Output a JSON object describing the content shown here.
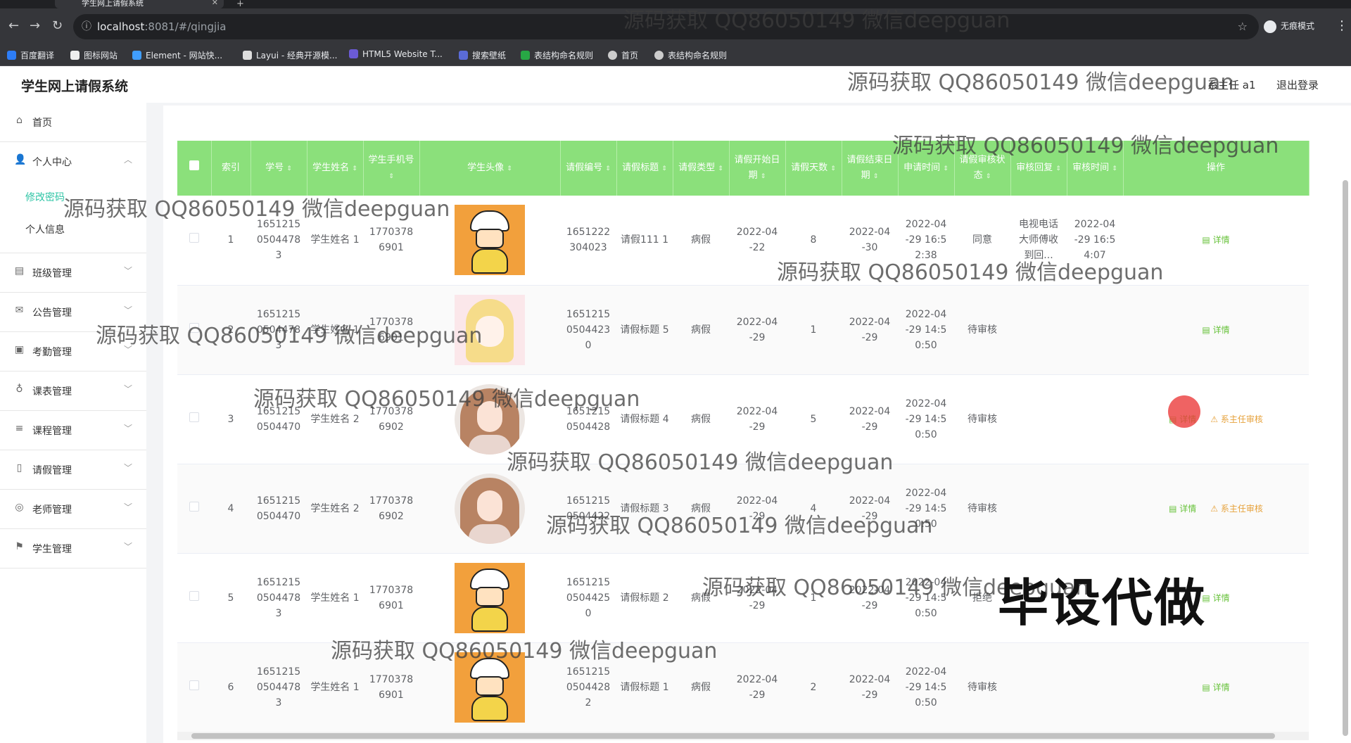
{
  "browser": {
    "tab_title": "学生网上请假系统",
    "url_host": "localhost",
    "url_path": ":8081/#/qingjia",
    "incognito_label": "无痕模式",
    "bookmarks": [
      "百度翻译",
      "图标网站",
      "Element - 网站快...",
      "Layui - 经典开源模...",
      "HTML5 Website T...",
      "搜索壁纸",
      "表结构命名规则",
      "首页",
      "表结构命名规则"
    ]
  },
  "header": {
    "title": "学生网上请假系统",
    "user_role": "系主任 a1",
    "logout": "退出登录"
  },
  "sidebar": {
    "home": "首页",
    "personal_center": "个人中心",
    "change_password": "修改密码",
    "personal_info": "个人信息",
    "items": [
      "班级管理",
      "公告管理",
      "考勤管理",
      "课表管理",
      "课程管理",
      "请假管理",
      "老师管理",
      "学生管理"
    ]
  },
  "table": {
    "headers": [
      "索引",
      "学号",
      "学生姓名",
      "学生手机号",
      "学生头像",
      "请假编号",
      "请假标题",
      "请假类型",
      "请假开始日期",
      "请假天数",
      "请假结束日期",
      "申请时间",
      "请假审核状态",
      "审核回复",
      "审核时间",
      "操作"
    ],
    "detail_label": "详情",
    "review_label": "系主任审核",
    "rows": [
      {
        "index": "1",
        "student_no": "1651215 0504478 3",
        "name": "学生姓名 1",
        "phone": "1770378 6901",
        "avatar": "cartoon",
        "leave_no": "1651222 304023",
        "title": "请假111 1",
        "type": "病假",
        "start": "2022-04 -22",
        "days": "8",
        "end": "2022-04 -30",
        "applied": "2022-04 -29 16:5 2:38",
        "status": "同意",
        "reply": "电视电话 大师傅收 到回...",
        "review_time": "2022-04 -29 16:5 4:07",
        "review_btn": false
      },
      {
        "index": "2",
        "student_no": "1651215 0504478 3",
        "name": "学生姓名 1",
        "phone": "1770378 6901",
        "avatar": "anime",
        "leave_no": "1651215 0504423 0",
        "title": "请假标题 5",
        "type": "病假",
        "start": "2022-04 -29",
        "days": "1",
        "end": "2022-04 -29",
        "applied": "2022-04 -29 14:5 0:50",
        "status": "待审核",
        "reply": "",
        "review_time": "",
        "review_btn": false
      },
      {
        "index": "3",
        "student_no": "1651215 0504470",
        "name": "学生姓名 2",
        "phone": "1770378 6902",
        "avatar": "girl",
        "leave_no": "1651215 0504428",
        "title": "请假标题 4",
        "type": "病假",
        "start": "2022-04 -29",
        "days": "5",
        "end": "2022-04 -29",
        "applied": "2022-04 -29 14:5 0:50",
        "status": "待审核",
        "reply": "",
        "review_time": "",
        "review_btn": true
      },
      {
        "index": "4",
        "student_no": "1651215 0504470",
        "name": "学生姓名 2",
        "phone": "1770378 6902",
        "avatar": "girl",
        "leave_no": "1651215 0504422",
        "title": "请假标题 3",
        "type": "病假",
        "start": "2022-04 -29",
        "days": "4",
        "end": "2022-04 -29",
        "applied": "2022-04 -29 14:5 0:50",
        "status": "待审核",
        "reply": "",
        "review_time": "",
        "review_btn": true
      },
      {
        "index": "5",
        "student_no": "1651215 0504478 3",
        "name": "学生姓名 1",
        "phone": "1770378 6901",
        "avatar": "cartoon",
        "leave_no": "1651215 0504425 0",
        "title": "请假标题 2",
        "type": "病假",
        "start": "2022-04 -29",
        "days": "1",
        "end": "2022-04 -29",
        "applied": "2022-04 -29 14:5 0:50",
        "status": "拒绝",
        "reply": "",
        "review_time": "",
        "review_btn": false
      },
      {
        "index": "6",
        "student_no": "1651215 0504478 3",
        "name": "学生姓名 1",
        "phone": "1770378 6901",
        "avatar": "cartoon",
        "leave_no": "1651215 0504428 2",
        "title": "请假标题 1",
        "type": "病假",
        "start": "2022-04 -29",
        "days": "2",
        "end": "2022-04 -29",
        "applied": "2022-04 -29 14:5 0:50",
        "status": "待审核",
        "reply": "",
        "review_time": "",
        "review_btn": false
      }
    ]
  },
  "overlay": {
    "watermark": "源码获取 QQ86050149 微信deepguan",
    "promo": "毕设代做"
  },
  "colors": {
    "header_green": "#8be07b",
    "accent_teal": "#2fc5a6",
    "detail_green": "#67c23a",
    "review_orange": "#e6a23c"
  }
}
